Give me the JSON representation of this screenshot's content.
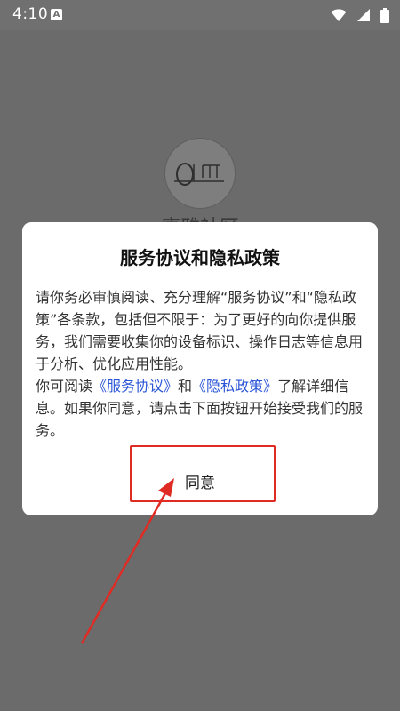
{
  "status_bar": {
    "time": "4:10",
    "notification_icon": "A"
  },
  "background_app": {
    "logo_text": "康雅社区",
    "app_name": "康雅社区"
  },
  "dialog": {
    "title": "服务协议和隐私政策",
    "paragraph1": "请你务必审慎阅读、充分理解“服务协议”和“隐私政策”各条款，包括但不限于：为了更好的向你提供服务，我们需要收集你的设备标识、操作日志等信息用于分析、优化应用性能。",
    "paragraph2_prefix": "你可阅读",
    "link_service": "《服务协议》",
    "conjunction": "和",
    "link_privacy": "《隐私政策》",
    "paragraph2_suffix": "了解详细信息。如果你同意，请点击下面按钮开始接受我们的服务。",
    "agree_label": "同意"
  },
  "colors": {
    "overlay": "#6b6b6b",
    "link": "#2b55d6",
    "annotation": "#e02b24"
  }
}
